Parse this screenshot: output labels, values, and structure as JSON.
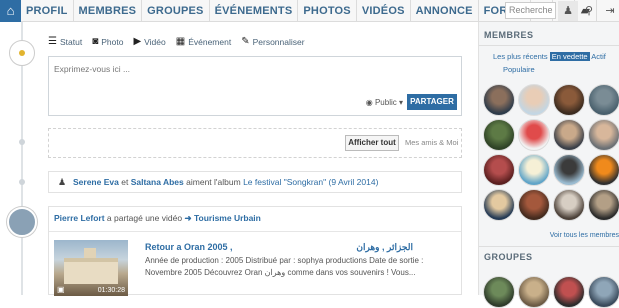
{
  "nav": {
    "home_icon": "home-icon",
    "items": [
      "PROFIL",
      "MEMBRES",
      "GROUPES",
      "ÉVÉNEMENTS",
      "PHOTOS",
      "VIDÉOS",
      "ANNONCE",
      "FORUM"
    ],
    "icons": [
      "globe-icon",
      "users-icon",
      "chat-icon"
    ],
    "search_placeholder": "Recherche"
  },
  "composer": {
    "tabs": [
      "Statut",
      "Photo",
      "Vidéo",
      "Événement",
      "Personnaliser"
    ],
    "placeholder": "Exprimez-vous ici ...",
    "privacy": "Public",
    "share_label": "PARTAGER"
  },
  "filter": {
    "show_all": "Afficher tout",
    "friends": "Mes amis & Moi"
  },
  "activity1": {
    "user1": "Serene Eva",
    "and": "et",
    "user2": "Saltana Abes",
    "text": "aiment l'album",
    "album": "Le festival \"Songkran\"",
    "date": "(9 Avril 2014)"
  },
  "activity2": {
    "user": "Pierre Lefort",
    "text": "a partagé une vidéo",
    "arrow": "➜",
    "category": "Tourisme Urbain",
    "video_title": "Retour a Oran 2005 ,",
    "video_title_ar": "الجزائر , وهران",
    "video_desc": "Année de production : 2005 Distribué par : sophya productions Date de sortie : Novembre 2005 Découvrez Oran وهران comme dans vos souvenirs ! Vous...",
    "duration": "01:30:28"
  },
  "sidebar": {
    "members_title": "MEMBRES",
    "tabs": [
      "Les plus récents",
      "En vedette",
      "Actif",
      "Populaire"
    ],
    "see_all": "Voir tous les membres",
    "groups_title": "GROUPES"
  }
}
